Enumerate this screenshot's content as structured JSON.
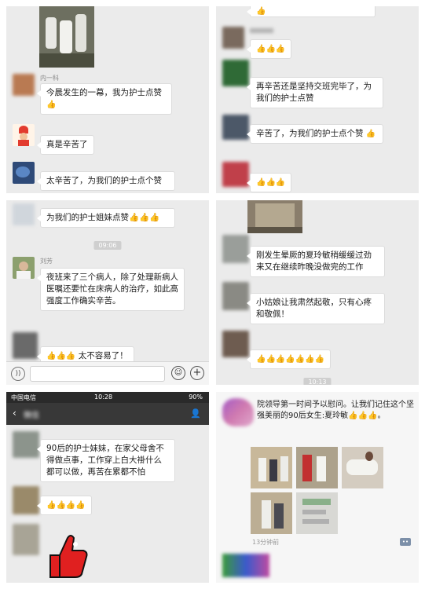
{
  "panel1": {
    "sender_name": "内一科",
    "msg1": "今晨发生的一幕，我为护士点赞",
    "msg1_emoji": "👍",
    "msg2": "真是辛苦了",
    "msg3": "太辛苦了，为我们的护士点个赞"
  },
  "panel2": {
    "top_emoji": "👍",
    "likes_a": "👍👍👍",
    "msg1": "再辛苦还是坚持交班完毕了，为我们的护士点赞",
    "msg2": "辛苦了，为我们的护士点个赞",
    "msg2_emoji": "👍",
    "likes_b": "👍👍👍"
  },
  "panel3": {
    "msg1": "为我们的护士姐妹点赞👍👍👍",
    "time": "09:06",
    "sender_name": "刘芳",
    "msg2": "夜班来了三个病人，除了处理新病人医嘱还要忙在床病人的治疗，如此高强度工作确实辛苦。",
    "msg3_emoji": "👍👍👍",
    "msg3": "太不容易了！"
  },
  "panel4": {
    "msg1": "刚发生晕厥的夏玲敏稍缓缓过劲来又在继续昨晚没做完的工作",
    "msg2": "小姑娘让我肃然起敬，只有心疼和敬佩！",
    "likes": "👍👍👍👍👍👍👍",
    "time": "10:13"
  },
  "panel5": {
    "carrier": "中国电信",
    "time": "10:28",
    "battery": "90%",
    "back_label": "微信",
    "msg1": "90后的护士妹妹，在家父母舍不得做点事，工作穿上白大褂什么都可以做，再苦在累都不怕",
    "likes": "👍👍👍👍"
  },
  "panel6": {
    "text": "院领导第一时间予以慰问。让我们记住这个坚强美丽的90后女生:夏玲敏👍👍👍。",
    "time_ago": "13分钟前",
    "more_icon": "••"
  },
  "colors": {
    "bubble": "#ffffff",
    "chat_bg": "#ebebeb",
    "nav_dark": "#383838",
    "thumb": "#e0a526",
    "thumb_red": "#e02020"
  }
}
